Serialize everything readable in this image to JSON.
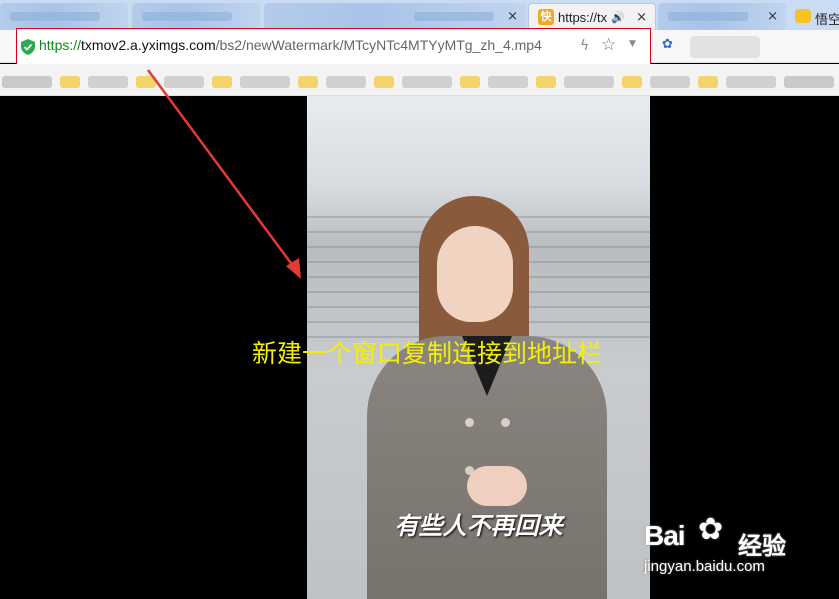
{
  "browser": {
    "tabs": [
      {
        "title": "",
        "state": "blurred"
      },
      {
        "title": "",
        "state": "blurred"
      },
      {
        "title": "",
        "state": "blurred",
        "close": "×"
      },
      {
        "title": "https://tx",
        "state": "active",
        "icon": "orange-app-icon",
        "audio": "speaker-icon"
      },
      {
        "title": "",
        "state": "blurred",
        "close": "×"
      },
      {
        "title": "悟空",
        "state": "partial",
        "icon": "yellow-app-icon"
      }
    ],
    "address_bar": {
      "scheme": "https://",
      "host": "txmov2.a.yximgs.com",
      "path": "/bs2/newWatermark/MTcyNTc4MTYyMTg_zh_4.mp4",
      "security_icon": "green-shield-icon"
    },
    "toolbar_icons": [
      "bolt-icon",
      "star-icon",
      "dropdown-icon",
      "baidu-paw-icon"
    ]
  },
  "video": {
    "subtitle": "有些人不再回来"
  },
  "annotation": {
    "text": "新建一个窗口复制连接到地址栏",
    "text_color": "#f5f000",
    "arrow_color": "#e53935",
    "highlight_color": "#d9001b"
  },
  "watermark": {
    "logo": "Bai",
    "brand": "经验",
    "url": "jingyan.baidu.com"
  }
}
